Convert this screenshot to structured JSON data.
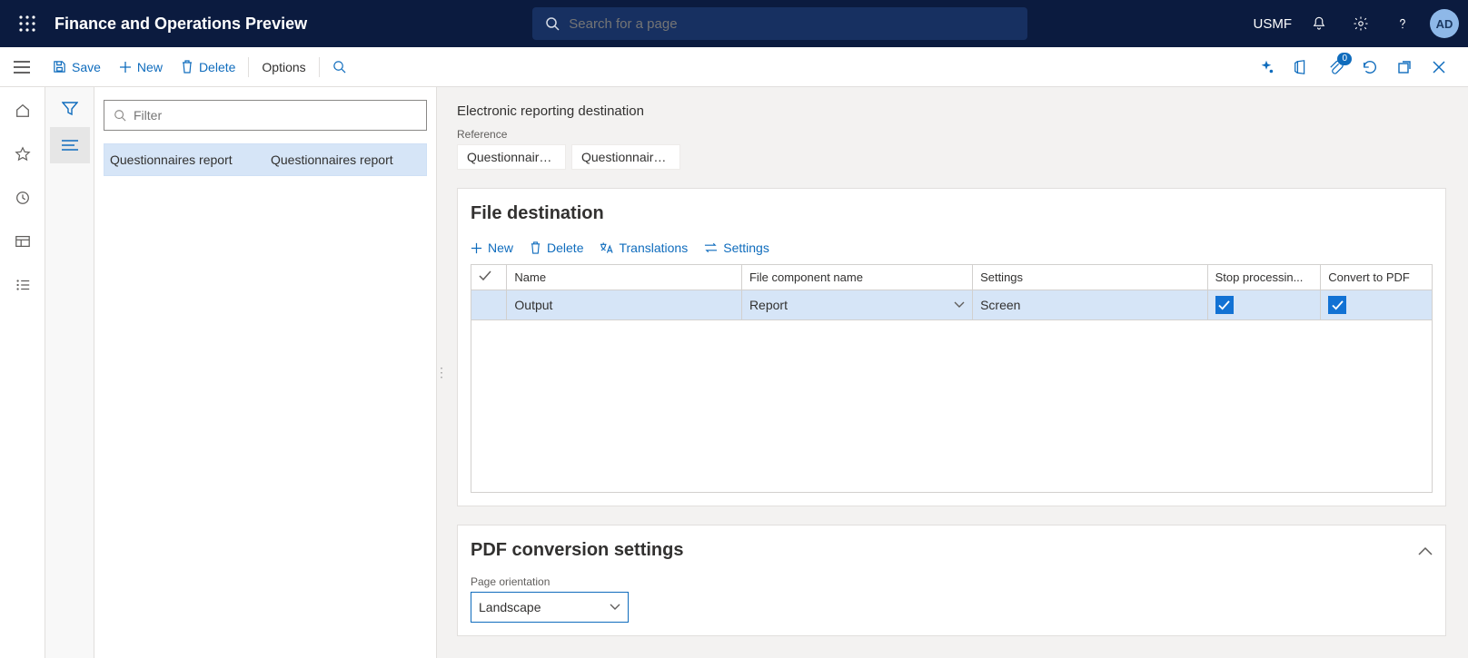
{
  "top": {
    "app_title": "Finance and Operations Preview",
    "search_placeholder": "Search for a page",
    "company": "USMF",
    "avatar": "AD",
    "badge_count": "0"
  },
  "actions": {
    "save": "Save",
    "new": "New",
    "delete": "Delete",
    "options": "Options"
  },
  "list": {
    "filter_placeholder": "Filter",
    "rows": [
      {
        "col1": "Questionnaires report",
        "col2": "Questionnaires report"
      }
    ]
  },
  "page": {
    "title": "Electronic reporting destination",
    "reference_label": "Reference",
    "chips": [
      "Questionnaire...",
      "Questionnaire..."
    ]
  },
  "file_destination": {
    "title": "File destination",
    "buttons": {
      "new": "New",
      "delete": "Delete",
      "translations": "Translations",
      "settings": "Settings"
    },
    "columns": {
      "name": "Name",
      "component": "File component name",
      "settings": "Settings",
      "stop": "Stop processin...",
      "convert": "Convert to PDF"
    },
    "row": {
      "name": "Output",
      "component": "Report",
      "settings": "Screen",
      "stop_checked": true,
      "convert_checked": true
    }
  },
  "pdf": {
    "title": "PDF conversion settings",
    "orientation_label": "Page orientation",
    "orientation_value": "Landscape"
  }
}
